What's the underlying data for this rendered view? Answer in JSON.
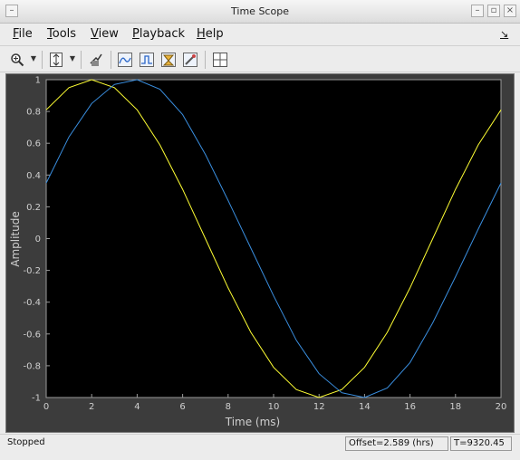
{
  "window": {
    "title": "Time Scope"
  },
  "menu": {
    "items": [
      "File",
      "Tools",
      "View",
      "Playback",
      "Help"
    ],
    "dock_glyph": "↘"
  },
  "toolbar": {
    "tools": [
      "zoom-in",
      "dropdown",
      "scale-axes",
      "dropdown",
      "highlight-simulink-signal",
      "signal-statistics",
      "bilevel-measurements",
      "peak-finder",
      "triggers",
      "properties",
      "layout"
    ]
  },
  "status": {
    "state": "Stopped",
    "offset": "Offset=2.589 (hrs)",
    "time": "T=9320.45"
  },
  "colors": {
    "plot_bg": "#000000",
    "panel_bg": "#3c3c3c",
    "axis_text": "#cfcfcf",
    "series1": "#ffff33",
    "series2": "#3a8fe0"
  },
  "chart_data": {
    "type": "line",
    "xlabel": "Time (ms)",
    "ylabel": "Amplitude",
    "xlim": [
      0,
      20
    ],
    "ylim": [
      -1,
      1
    ],
    "xticks": [
      0,
      2,
      4,
      6,
      8,
      10,
      12,
      14,
      16,
      18,
      20
    ],
    "yticks": [
      1,
      0.8,
      0.6,
      0.4,
      0.2,
      0,
      -0.2,
      -0.4,
      -0.6,
      -0.8,
      -1
    ],
    "grid": false,
    "series": [
      {
        "color": "#ffff33",
        "x": [
          0,
          1,
          2,
          3,
          4,
          5,
          6,
          7,
          8,
          9,
          10,
          11,
          12,
          13,
          14,
          15,
          16,
          17,
          18,
          19,
          20
        ],
        "y": [
          0.81,
          0.95,
          1.0,
          0.95,
          0.81,
          0.59,
          0.31,
          0.0,
          -0.31,
          -0.59,
          -0.81,
          -0.95,
          -1.0,
          -0.95,
          -0.81,
          -0.59,
          -0.31,
          0.0,
          0.31,
          0.59,
          0.81
        ]
      },
      {
        "color": "#3a8fe0",
        "x": [
          0,
          1,
          2,
          3,
          4,
          5,
          6,
          7,
          8,
          9,
          10,
          11,
          12,
          13,
          14,
          15,
          16,
          17,
          18,
          19,
          20
        ],
        "y": [
          0.35,
          0.64,
          0.85,
          0.97,
          1.0,
          0.94,
          0.78,
          0.53,
          0.24,
          -0.06,
          -0.36,
          -0.64,
          -0.85,
          -0.97,
          -1.0,
          -0.94,
          -0.78,
          -0.53,
          -0.24,
          0.06,
          0.35
        ]
      }
    ]
  }
}
